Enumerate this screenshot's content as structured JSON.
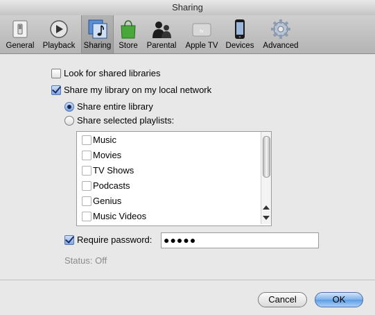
{
  "window": {
    "title": "Sharing"
  },
  "toolbar": {
    "items": [
      {
        "label": "General",
        "icon": "general-switch-icon"
      },
      {
        "label": "Playback",
        "icon": "play-icon"
      },
      {
        "label": "Sharing",
        "icon": "sharing-icon",
        "selected": true
      },
      {
        "label": "Store",
        "icon": "shopping-bag-icon"
      },
      {
        "label": "Parental",
        "icon": "parental-people-icon"
      },
      {
        "label": "Apple TV",
        "icon": "apple-tv-icon"
      },
      {
        "label": "Devices",
        "icon": "iphone-icon"
      },
      {
        "label": "Advanced",
        "icon": "gear-icon"
      }
    ]
  },
  "options": {
    "look_for_shared": {
      "label": "Look for shared libraries",
      "checked": false
    },
    "share_library": {
      "label": "Share my library on my local network",
      "checked": true
    },
    "share_entire": {
      "label": "Share entire library",
      "selected": true
    },
    "share_selected": {
      "label": "Share selected playlists:",
      "selected": false
    }
  },
  "playlists": [
    {
      "label": "Music",
      "checked": false
    },
    {
      "label": "Movies",
      "checked": false
    },
    {
      "label": "TV Shows",
      "checked": false
    },
    {
      "label": "Podcasts",
      "checked": false
    },
    {
      "label": "Genius",
      "checked": false
    },
    {
      "label": "Music Videos",
      "checked": false
    }
  ],
  "password": {
    "label": "Require password:",
    "checked": true,
    "value": "●●●●●"
  },
  "status": "Status: Off",
  "buttons": {
    "cancel": "Cancel",
    "ok": "OK"
  },
  "colors": {
    "accent": "#5d9ce2",
    "status_text": "#8a8a8a"
  }
}
